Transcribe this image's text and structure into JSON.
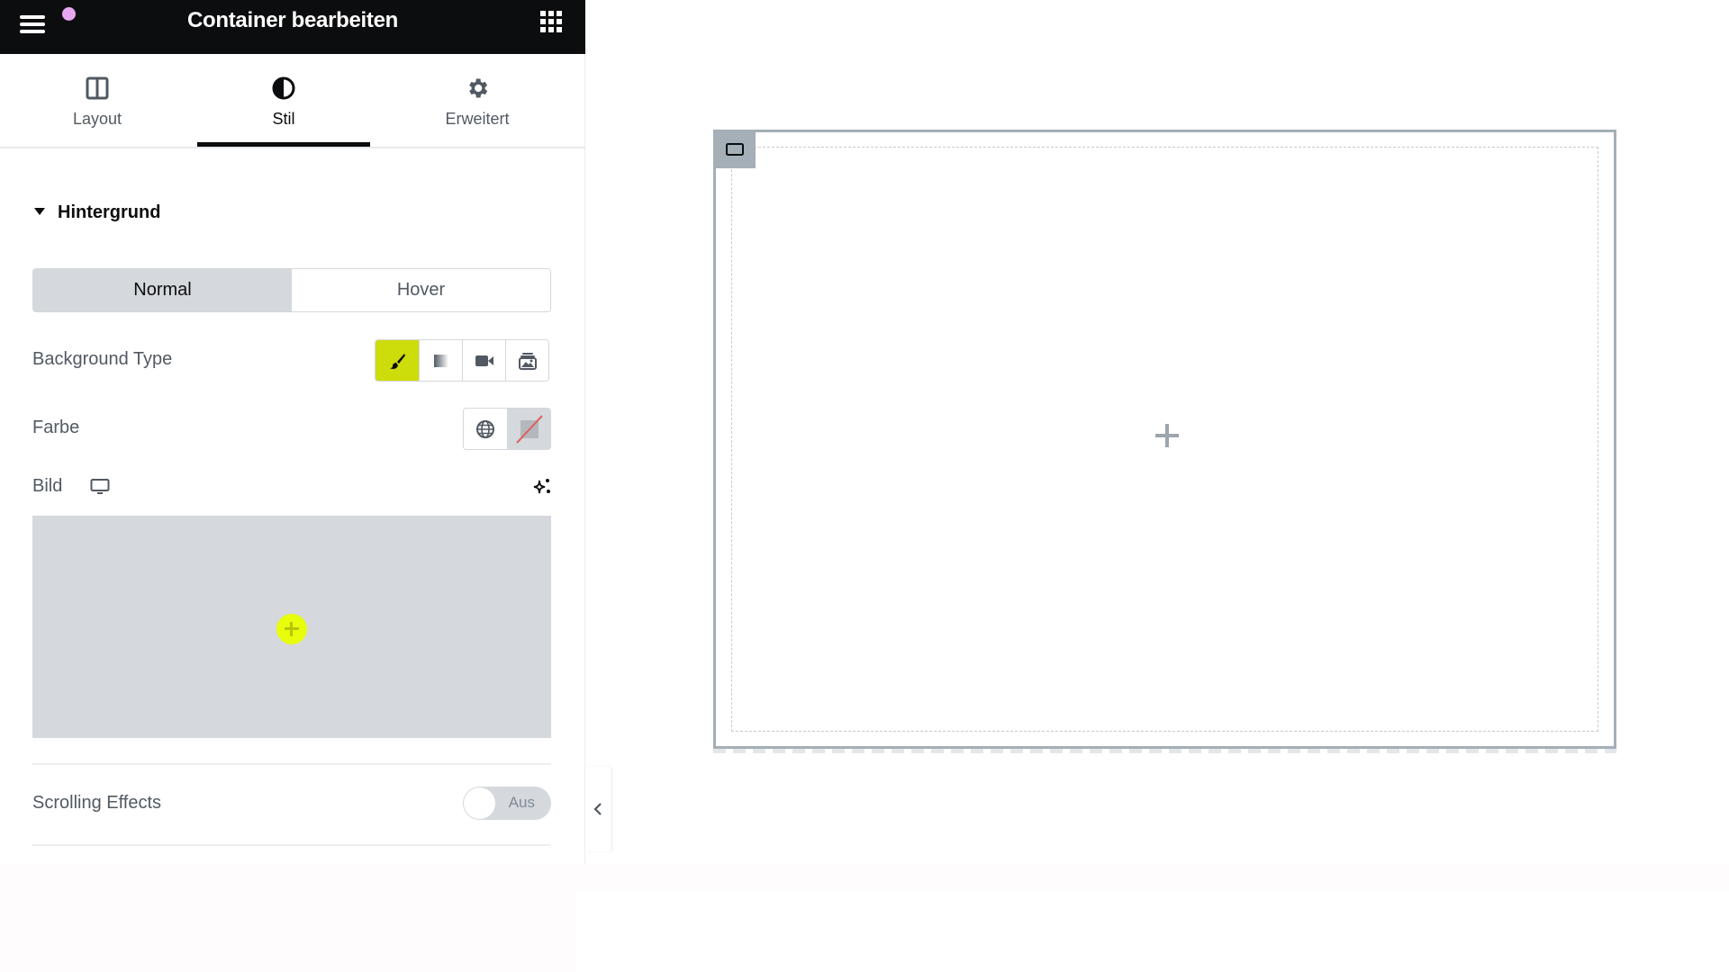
{
  "header": {
    "title": "Container bearbeiten",
    "menu_icon": "hamburger-icon",
    "apps_icon": "grid-apps-icon",
    "notification_color": "#e7a7f0"
  },
  "tabs": [
    {
      "label": "Layout",
      "icon": "columns-layout-icon",
      "active": false
    },
    {
      "label": "Stil",
      "icon": "half-circle-style-icon",
      "active": true
    },
    {
      "label": "Erweitert",
      "icon": "gear-icon",
      "active": false
    }
  ],
  "section": {
    "title": "Hintergrund",
    "expanded": true
  },
  "state_toggle": {
    "options": [
      "Normal",
      "Hover"
    ],
    "selected": "Normal"
  },
  "controls": {
    "background_type": {
      "label": "Background Type",
      "options": [
        {
          "name": "classic",
          "icon": "paint-brush-icon",
          "active": true
        },
        {
          "name": "gradient",
          "icon": "gradient-icon",
          "active": false
        },
        {
          "name": "video",
          "icon": "video-camera-icon",
          "active": false
        },
        {
          "name": "slideshow",
          "icon": "slideshow-images-icon",
          "active": false
        }
      ]
    },
    "color": {
      "label": "Farbe",
      "global_icon": "globe-icon",
      "value": "none"
    },
    "image": {
      "label": "Bild",
      "responsive_icon": "desktop-monitor-icon",
      "ai_icon": "sparkle-ai-icon"
    },
    "scrolling_effects": {
      "label": "Scrolling Effects",
      "state_label": "Aus",
      "enabled": false
    }
  },
  "colors": {
    "accent": "#cddc0b",
    "header_bg": "#0c0d0e",
    "container_border": "#a4afb7"
  }
}
